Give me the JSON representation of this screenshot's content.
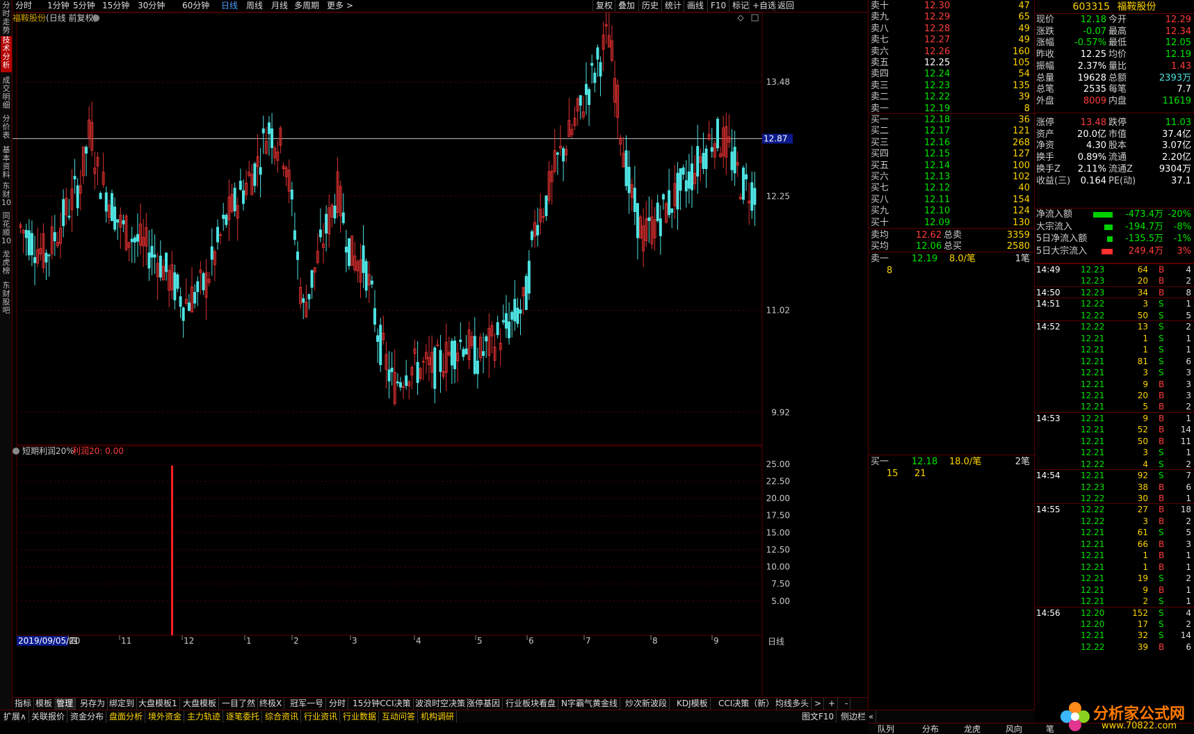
{
  "sidebar": [
    "分时走势",
    "技术分析",
    "成交明细",
    "分价表",
    "基本资料",
    "东财10",
    "同花顺10",
    "龙虎榜",
    "东财股吧"
  ],
  "periods": [
    "分时",
    "1分钟",
    "5分钟",
    "15分钟",
    "30分钟",
    "60分钟",
    "日线",
    "周线",
    "月线",
    "多周期",
    "更多 >"
  ],
  "period_active": "日线",
  "toolbar_right": [
    "复权",
    "叠加",
    "历史",
    "统计",
    "画线",
    "F10",
    "标记",
    "+自选",
    "返回"
  ],
  "stock": {
    "code": "603315",
    "name": "福鞍股份",
    "chart_title": "福鞍股份",
    "chart_title_suffix": "(日线 前复权)"
  },
  "indicator": {
    "name": "短期利润20%",
    "label": "利润20: 0.00"
  },
  "crosshair_price": "12.87",
  "date_label": "2019/09/05/四",
  "cycle_label": "日线",
  "colors": {
    "up": "#e03030",
    "down": "#4fe3e3",
    "bg": "#000000",
    "grid": "#5a0000",
    "accent": "#ffd400"
  },
  "orderbook": {
    "asks": [
      [
        "卖十",
        "12.30",
        "47"
      ],
      [
        "卖九",
        "12.29",
        "65"
      ],
      [
        "卖八",
        "12.28",
        "49"
      ],
      [
        "卖七",
        "12.27",
        "49"
      ],
      [
        "卖六",
        "12.26",
        "160"
      ],
      [
        "卖五",
        "12.25",
        "105"
      ],
      [
        "卖四",
        "12.24",
        "54"
      ],
      [
        "卖三",
        "12.23",
        "135"
      ],
      [
        "卖二",
        "12.22",
        "39"
      ],
      [
        "卖一",
        "12.19",
        "8"
      ]
    ],
    "bids": [
      [
        "买一",
        "12.18",
        "36"
      ],
      [
        "买二",
        "12.17",
        "121"
      ],
      [
        "买三",
        "12.16",
        "268"
      ],
      [
        "买四",
        "12.15",
        "127"
      ],
      [
        "买五",
        "12.14",
        "100"
      ],
      [
        "买六",
        "12.13",
        "102"
      ],
      [
        "买七",
        "12.12",
        "40"
      ],
      [
        "买八",
        "12.11",
        "154"
      ],
      [
        "买九",
        "12.10",
        "124"
      ],
      [
        "买十",
        "12.09",
        "130"
      ]
    ],
    "ask_avg_label": "卖均",
    "ask_avg": "12.62",
    "ask_total_label": "总卖",
    "ask_total": "3359",
    "bid_avg_label": "买均",
    "bid_avg": "12.06",
    "bid_total_label": "总买",
    "bid_total": "2580",
    "queue_ask": {
      "label": "卖一",
      "price": "12.19",
      "per": "8.0/笔",
      "count": "1笔",
      "orders": [
        "8"
      ]
    },
    "queue_bid": {
      "label": "买一",
      "price": "12.18",
      "per": "18.0/笔",
      "count": "2笔",
      "orders": [
        "15",
        "21"
      ]
    }
  },
  "quote": [
    [
      "现价",
      "12.18",
      "今开",
      "12.29"
    ],
    [
      "涨跌",
      "-0.07",
      "最高",
      "12.34"
    ],
    [
      "涨幅",
      "-0.57%",
      "最低",
      "12.05"
    ],
    [
      "昨收",
      "12.25",
      "均价",
      "12.19"
    ],
    [
      "振幅",
      "2.37%",
      "量比",
      "1.43"
    ],
    [
      "总量",
      "19628",
      "总额",
      "2393万"
    ],
    [
      "总笔",
      "2535",
      "每笔",
      "7.7"
    ],
    [
      "外盘",
      "8009",
      "内盘",
      "11619"
    ],
    [
      "涨停",
      "13.48",
      "跌停",
      "11.03"
    ],
    [
      "资产",
      "20.0亿",
      "市值",
      "37.4亿"
    ],
    [
      "净资",
      "4.30",
      "股本",
      "3.07亿"
    ],
    [
      "换手",
      "0.89%",
      "流通",
      "2.20亿"
    ],
    [
      "换手Z",
      "2.11%",
      "流通Z",
      "9304万"
    ],
    [
      "收益(三)",
      "0.164",
      "PE(动)",
      "37.1"
    ]
  ],
  "flows": [
    [
      "净流入额",
      "-473.4万",
      "-20%"
    ],
    [
      "大宗流入",
      "-194.7万",
      "-8%"
    ],
    [
      "5日净流入额",
      "-135.5万",
      "-1%"
    ],
    [
      "5日大宗流入",
      "249.4万",
      "3%"
    ]
  ],
  "ticks": [
    [
      "14:49",
      "12.23",
      "64",
      "B",
      "4"
    ],
    [
      "",
      "12.23",
      "20",
      "B",
      "2"
    ],
    [
      "14:50",
      "12.23",
      "34",
      "B",
      "8"
    ],
    [
      "14:51",
      "12.22",
      "3",
      "S",
      "1"
    ],
    [
      "",
      "12.22",
      "50",
      "S",
      "5"
    ],
    [
      "14:52",
      "12.22",
      "13",
      "S",
      "2"
    ],
    [
      "",
      "12.21",
      "1",
      "S",
      "1"
    ],
    [
      "",
      "12.21",
      "1",
      "S",
      "1"
    ],
    [
      "",
      "12.21",
      "81",
      "S",
      "6"
    ],
    [
      "",
      "12.21",
      "3",
      "S",
      "3"
    ],
    [
      "",
      "12.21",
      "9",
      "B",
      "3"
    ],
    [
      "",
      "12.21",
      "20",
      "B",
      "3"
    ],
    [
      "",
      "12.21",
      "5",
      "B",
      "2"
    ],
    [
      "14:53",
      "12.21",
      "9",
      "B",
      "1"
    ],
    [
      "",
      "12.21",
      "52",
      "B",
      "14"
    ],
    [
      "",
      "12.21",
      "50",
      "B",
      "11"
    ],
    [
      "",
      "12.21",
      "3",
      "S",
      "1"
    ],
    [
      "",
      "12.22",
      "4",
      "S",
      "2"
    ],
    [
      "14:54",
      "12.21",
      "92",
      "S",
      "7"
    ],
    [
      "",
      "12.23",
      "38",
      "B",
      "6"
    ],
    [
      "",
      "12.22",
      "30",
      "B",
      "1"
    ],
    [
      "14:55",
      "12.22",
      "27",
      "B",
      "18"
    ],
    [
      "",
      "12.22",
      "3",
      "B",
      "2"
    ],
    [
      "",
      "12.21",
      "61",
      "S",
      "5"
    ],
    [
      "",
      "12.21",
      "66",
      "B",
      "3"
    ],
    [
      "",
      "12.21",
      "1",
      "B",
      "1"
    ],
    [
      "",
      "12.21",
      "1",
      "B",
      "1"
    ],
    [
      "",
      "12.21",
      "19",
      "S",
      "2"
    ],
    [
      "",
      "12.21",
      "9",
      "B",
      "1"
    ],
    [
      "",
      "12.21",
      "2",
      "S",
      "1"
    ],
    [
      "14:56",
      "12.20",
      "152",
      "S",
      "4"
    ],
    [
      "",
      "12.20",
      "17",
      "S",
      "2"
    ],
    [
      "",
      "12.21",
      "32",
      "S",
      "14"
    ],
    [
      "",
      "12.22",
      "39",
      "B",
      "6"
    ]
  ],
  "bottom_tabs": [
    "指标",
    "模板",
    "管理",
    "另存为",
    "绑定到",
    "大盘模板1",
    "大盘模板",
    "一目了然",
    "终极X",
    "冠军一号",
    "分时",
    "15分钟CCI决策",
    "波浪时空决策",
    "涨停基因",
    "行业板块看盘",
    "N字霸气黄金线",
    "炒次新波段",
    "KDJ模板",
    "CCI决策（新）",
    "均线多头",
    ">",
    "+",
    "-"
  ],
  "bottom_tab_active": "管理",
  "bottom_row2": [
    "扩展∧",
    "关联报价",
    "资金分布",
    "盘面分析",
    "境外资金",
    "主力轨迹",
    "逐笔委托",
    "综合资讯",
    "行业资讯",
    "行业数据",
    "互动问答",
    "机构调研"
  ],
  "bottom_row2_right": [
    "图文F10",
    "侧边栏 «"
  ],
  "bottom_row3": [
    "队列",
    "分布",
    "龙虎",
    "风向",
    "笔"
  ],
  "watermark": {
    "brand": "分析家公式网",
    "url": "www.70822.com"
  },
  "chart_data": [
    {
      "type": "candlestick",
      "title": "福鞍股份 (日线 前复权)",
      "y_ticks": [
        "13.48",
        "12.25",
        "11.02",
        "9.92"
      ],
      "ylim": [
        9.6,
        14.2
      ],
      "x_month_labels": [
        "10",
        "11",
        "12",
        "1",
        "2",
        "3",
        "4",
        "5",
        "6",
        "7",
        "8",
        "9"
      ],
      "note": "daily candles; series approximated from visual"
    },
    {
      "type": "bar",
      "title": "短期利润20%",
      "series": [
        {
          "name": "利润20",
          "values": [
            24.8
          ]
        }
      ],
      "y_ticks": [
        "25.00",
        "22.50",
        "20.00",
        "17.50",
        "15.00",
        "12.50",
        "10.00",
        "7.50",
        "5.00"
      ],
      "ylim": [
        0,
        26
      ]
    }
  ]
}
